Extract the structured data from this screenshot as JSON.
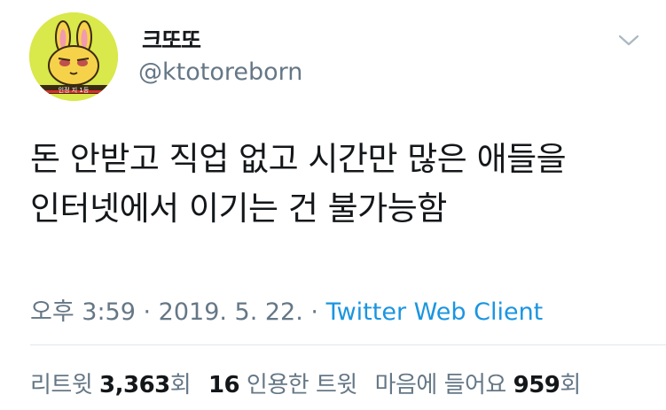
{
  "user": {
    "display_name": "크또또",
    "handle": "@ktotoreborn",
    "avatar_caption": "인정 지 1등",
    "avatar_icon": "rabbit-character-avatar"
  },
  "tweet": {
    "lines": [
      "돈 안받고 직업 없고 시간만 많은 애들을",
      "인터넷에서 이기는 건 불가능함"
    ]
  },
  "meta": {
    "time": "오후 3:59",
    "separator": " · ",
    "date": "2019. 5. 22.",
    "client": "Twitter Web Client"
  },
  "stats": {
    "retweets_label": "리트윗",
    "retweets_count": "3,363",
    "retweets_suffix": "회",
    "quotes_count": "16",
    "quotes_label": "인용한 트윗",
    "likes_label": "마음에 들어요",
    "likes_count": "959",
    "likes_suffix": "회"
  },
  "colors": {
    "text": "#14171a",
    "secondary": "#657786",
    "link": "#1b95e0",
    "avatar_bg": "#d9e84a"
  },
  "icons": {
    "more": "chevron-down-icon"
  }
}
